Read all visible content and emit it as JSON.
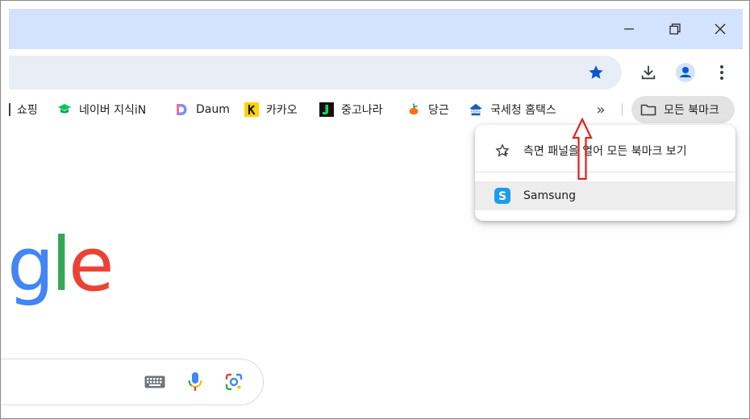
{
  "window": {
    "controls": [
      "minimize-icon",
      "restore-icon",
      "close-icon"
    ]
  },
  "toolbar": {
    "icons": [
      "star-icon",
      "download-icon",
      "profile-icon",
      "menu-icon"
    ],
    "accent": "#0b57d0"
  },
  "bookmarks": {
    "items": [
      {
        "label": "쇼핑",
        "icon": "shopping-icon"
      },
      {
        "label": "네이버 지식iN",
        "icon": "naver-kin-icon"
      },
      {
        "label": "Daum",
        "icon": "daum-icon"
      },
      {
        "label": "카카오",
        "icon": "kakao-icon"
      },
      {
        "label": "중고나라",
        "icon": "joonggonara-icon"
      },
      {
        "label": "당근",
        "icon": "daangn-icon"
      },
      {
        "label": "국세청 홈택스",
        "icon": "hometax-icon"
      }
    ],
    "more_glyph": "»",
    "all_bookmarks_label": "모든 북마크"
  },
  "dropdown": {
    "side_panel_label": "측면 패널을 열어 모든 북마크 보기",
    "folder_item_label": "Samsung"
  },
  "page": {
    "logo_letters": [
      "g",
      "l",
      "e"
    ],
    "logo_colors": [
      "#4285f4",
      "#34a853",
      "#ea4335"
    ]
  }
}
